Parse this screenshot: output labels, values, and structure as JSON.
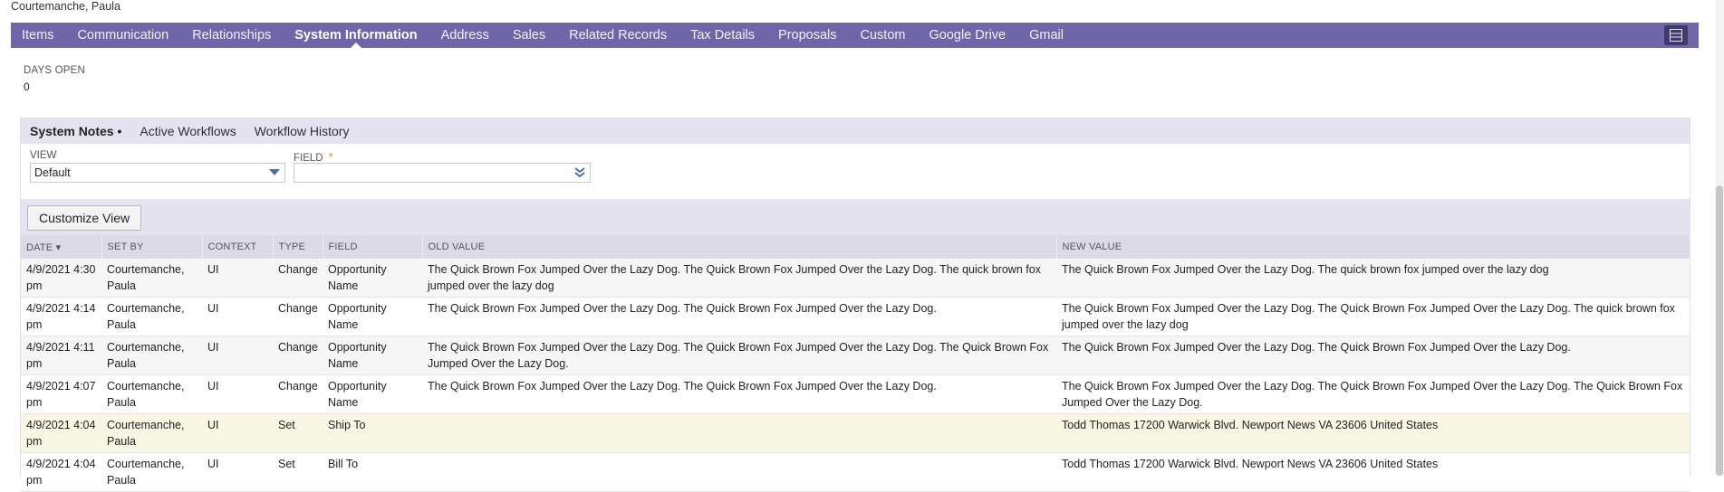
{
  "record": {
    "name": "Courtemanche, Paula"
  },
  "tabs": [
    {
      "label": "Items"
    },
    {
      "label": "Communication"
    },
    {
      "label": "Relationships"
    },
    {
      "label": "System Information",
      "active": true
    },
    {
      "label": "Address"
    },
    {
      "label": "Sales"
    },
    {
      "label": "Related Records"
    },
    {
      "label": "Tax Details"
    },
    {
      "label": "Proposals"
    },
    {
      "label": "Custom"
    },
    {
      "label": "Google Drive"
    },
    {
      "label": "Gmail"
    }
  ],
  "days_open": {
    "label": "DAYS OPEN",
    "value": "0"
  },
  "subtabs": [
    {
      "label": "System Notes •",
      "active": true
    },
    {
      "label": "Active Workflows"
    },
    {
      "label": "Workflow History"
    }
  ],
  "filters": {
    "view_label": "VIEW",
    "view_value": "Default",
    "field_label": "FIELD",
    "field_required": "*",
    "field_value": ""
  },
  "customize_button": "Customize View",
  "table": {
    "headers": [
      "DATE ▾",
      "SET BY",
      "CONTEXT",
      "TYPE",
      "FIELD",
      "OLD VALUE",
      "NEW VALUE"
    ],
    "rows": [
      [
        "4/9/2021 4:30 pm",
        "Courtemanche, Paula",
        "UI",
        "Change",
        "Opportunity Name",
        "The Quick Brown Fox Jumped Over the Lazy Dog. The Quick Brown Fox Jumped Over the Lazy Dog. The quick brown fox jumped over the lazy dog",
        "The Quick Brown Fox Jumped Over the Lazy Dog. The quick brown fox jumped over the lazy dog"
      ],
      [
        "4/9/2021 4:14 pm",
        "Courtemanche, Paula",
        "UI",
        "Change",
        "Opportunity Name",
        "The Quick Brown Fox Jumped Over the Lazy Dog. The Quick Brown Fox Jumped Over the Lazy Dog.",
        "The Quick Brown Fox Jumped Over the Lazy Dog. The Quick Brown Fox Jumped Over the Lazy Dog. The quick brown fox jumped over the lazy dog"
      ],
      [
        "4/9/2021 4:11 pm",
        "Courtemanche, Paula",
        "UI",
        "Change",
        "Opportunity Name",
        "The Quick Brown Fox Jumped Over the Lazy Dog. The Quick Brown Fox Jumped Over the Lazy Dog. The Quick Brown Fox Jumped Over the Lazy Dog.",
        "The Quick Brown Fox Jumped Over the Lazy Dog. The Quick Brown Fox Jumped Over the Lazy Dog."
      ],
      [
        "4/9/2021 4:07 pm",
        "Courtemanche, Paula",
        "UI",
        "Change",
        "Opportunity Name",
        "The Quick Brown Fox Jumped Over the Lazy Dog. The Quick Brown Fox Jumped Over the Lazy Dog.",
        "The Quick Brown Fox Jumped Over the Lazy Dog. The Quick Brown Fox Jumped Over the Lazy Dog. The Quick Brown Fox Jumped Over the Lazy Dog."
      ],
      [
        "4/9/2021 4:04 pm",
        "Courtemanche, Paula",
        "UI",
        "Set",
        "Ship To",
        "",
        "Todd Thomas 17200 Warwick Blvd. Newport News VA 23606 United States"
      ],
      [
        "4/9/2021 4:04 pm",
        "Courtemanche, Paula",
        "UI",
        "Set",
        "Bill To",
        "",
        "Todd Thomas 17200 Warwick Blvd. Newport News VA 23606 United States"
      ]
    ]
  },
  "colors": {
    "tabbar": "#6f66a8",
    "subtabbar": "#e5e3ef",
    "highlight_row": "#f7f7e3"
  },
  "icons": {
    "menu": "layout-toggle-icon",
    "view_caret": "caret-down-icon",
    "field_caret": "double-chevron-down-icon"
  }
}
